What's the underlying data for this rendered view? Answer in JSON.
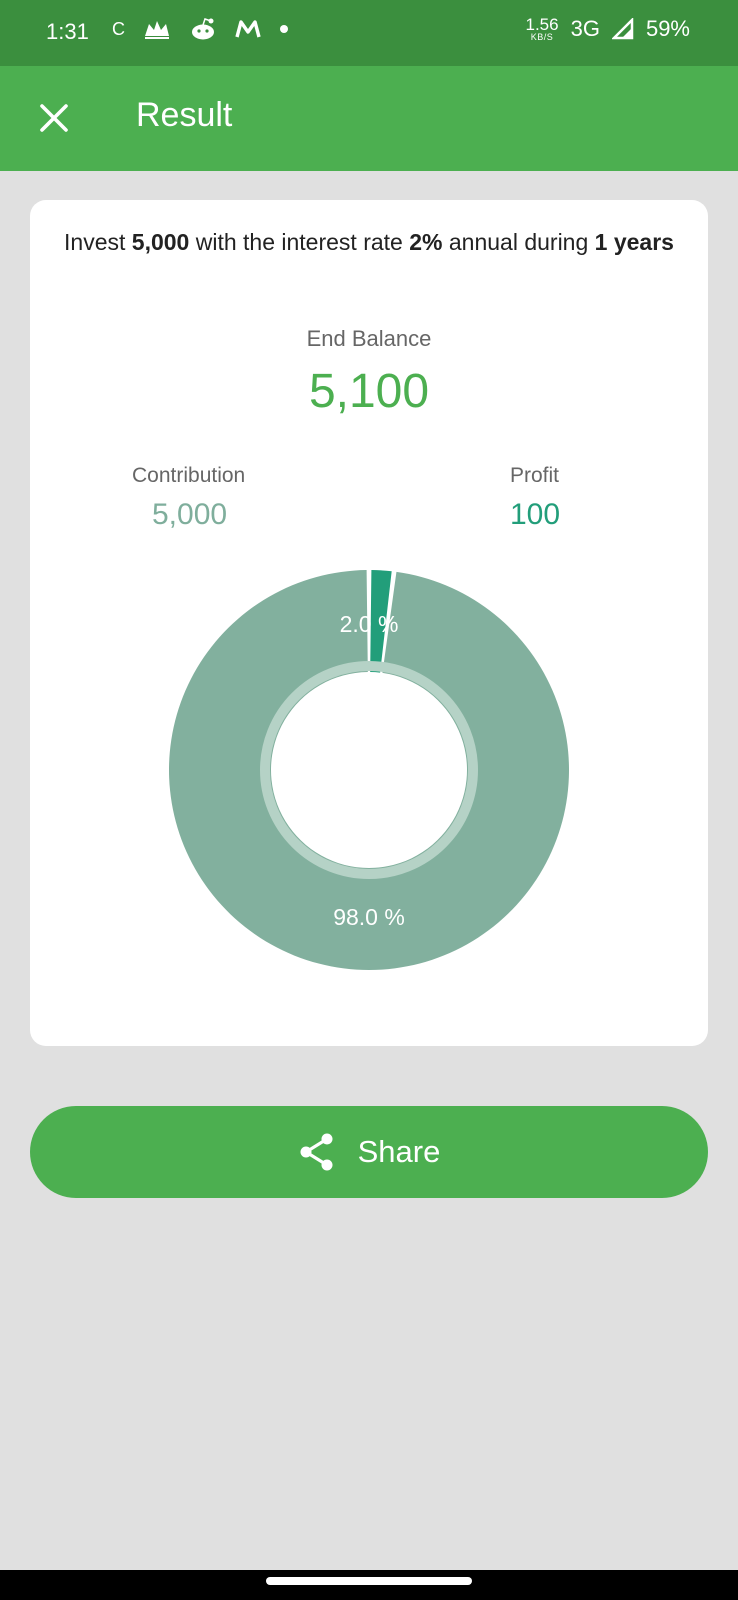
{
  "status_bar": {
    "time": "1:31",
    "left_icons": [
      "c-icon",
      "crown-icon",
      "reddit-icon",
      "m-icon",
      "dot-icon"
    ],
    "c_text": "C",
    "net_speed": "1.56",
    "net_speed_unit": "KB/S",
    "network": "3G",
    "battery": "59%"
  },
  "app_bar": {
    "title": "Result",
    "close_icon": "close-icon"
  },
  "result": {
    "summary": {
      "prefix": "Invest ",
      "amount": "5,000",
      "middle": " with the interest rate ",
      "rate": "2%",
      "suffix": " annual during ",
      "years": "1 years"
    },
    "end_balance_label": "End Balance",
    "end_balance_value": "5,100",
    "contribution_label": "Contribution",
    "contribution_value": "5,000",
    "profit_label": "Profit",
    "profit_value": "100"
  },
  "chart_data": {
    "type": "pie",
    "categories": [
      "Profit",
      "Contribution"
    ],
    "values": [
      2.0,
      98.0
    ],
    "labels": [
      "2.0 %",
      "98.0 %"
    ],
    "colors": [
      "#229e7a",
      "#82b09e"
    ]
  },
  "share": {
    "label": "Share",
    "icon": "share-icon"
  },
  "colors": {
    "status_bar": "#3b8f3e",
    "primary": "#4caf50",
    "background": "#e0e0e0",
    "contribution": "#82b09e",
    "profit": "#229e7a"
  }
}
